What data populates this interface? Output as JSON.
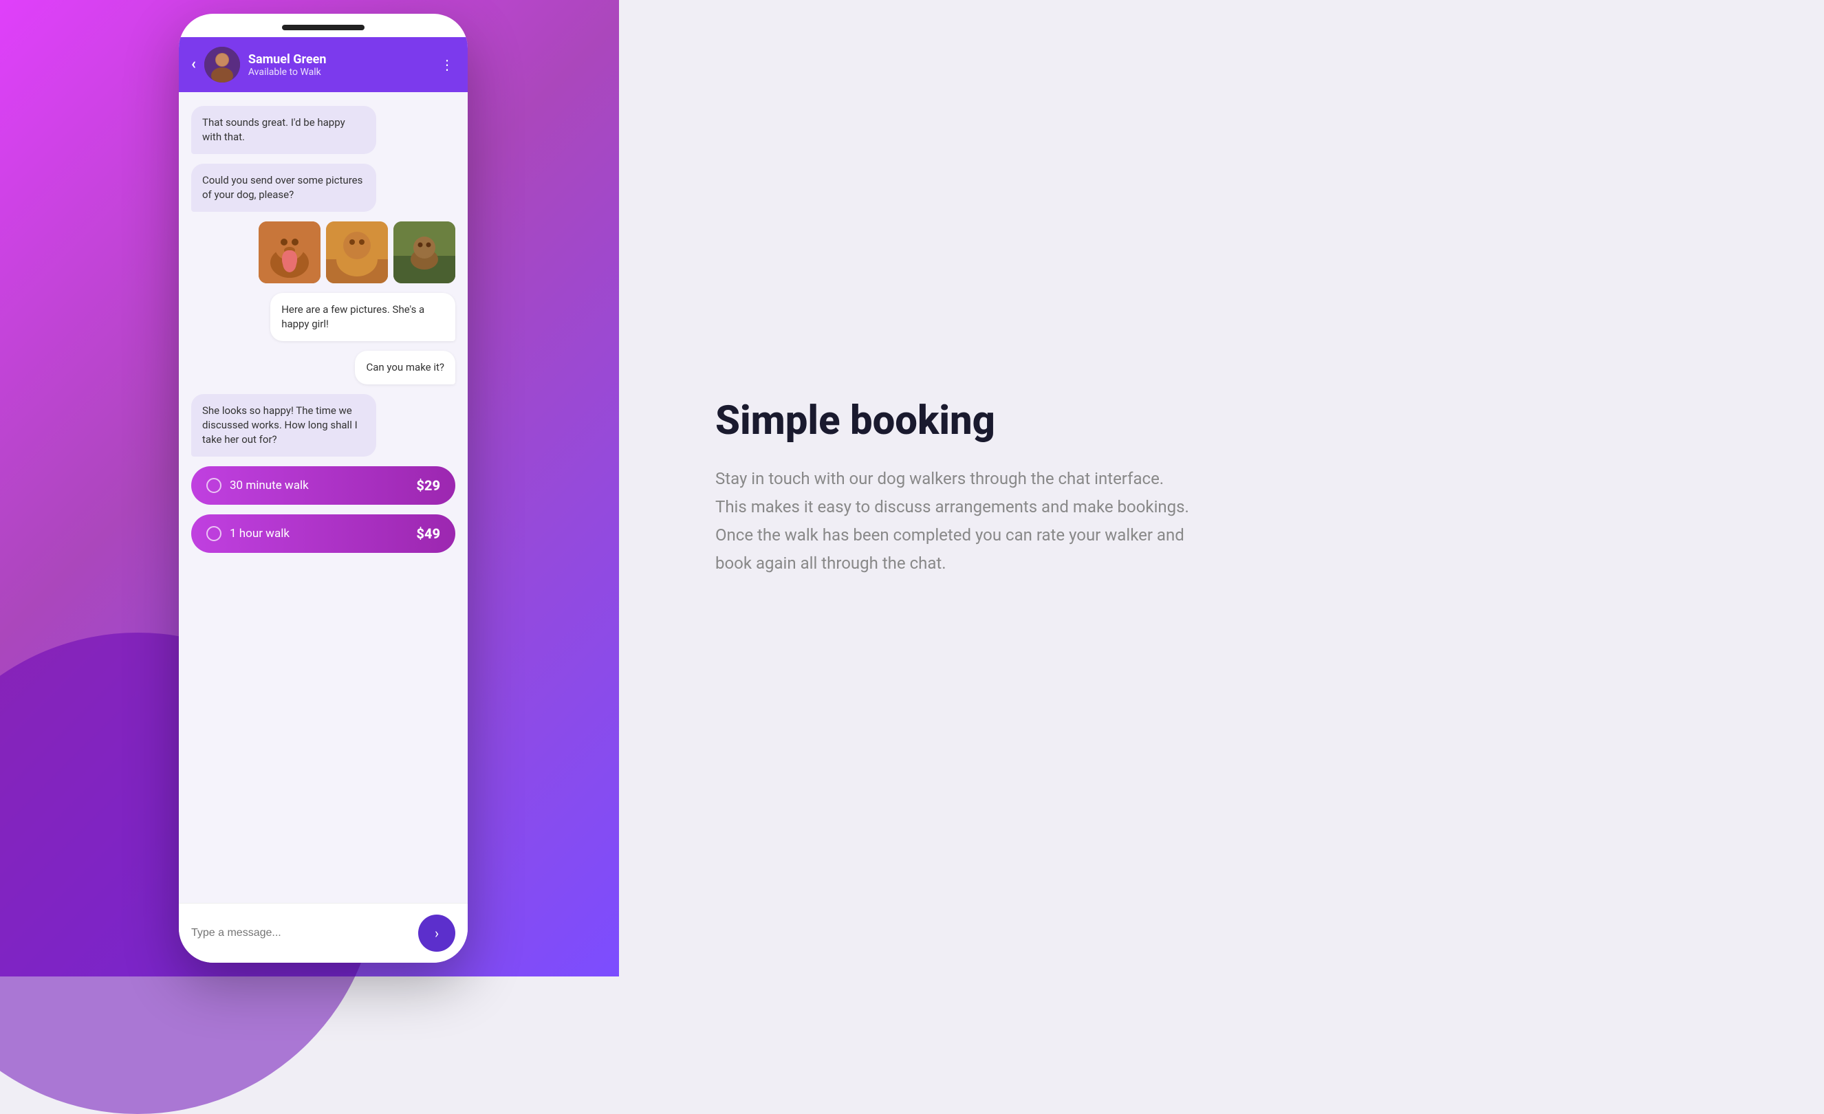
{
  "background": {
    "left_gradient_start": "#e040fb",
    "left_gradient_end": "#7c4dff"
  },
  "phone": {
    "notch": true
  },
  "header": {
    "back_label": "‹",
    "user_name": "Samuel Green",
    "user_status": "Available to Walk",
    "more_label": "⋮"
  },
  "messages": [
    {
      "id": 1,
      "type": "received",
      "text": "That sounds great. I'd be happy with that."
    },
    {
      "id": 2,
      "type": "received",
      "text": "Could you send over some pictures of your dog, please?"
    },
    {
      "id": 3,
      "type": "photos",
      "count": 3
    },
    {
      "id": 4,
      "type": "sent",
      "text": "Here are a few pictures. She's a happy girl!"
    },
    {
      "id": 5,
      "type": "sent",
      "text": "Can you make it?"
    },
    {
      "id": 6,
      "type": "received",
      "text": "She looks so happy! The time we discussed works. How long shall I take her out for?"
    }
  ],
  "walk_options": [
    {
      "id": 1,
      "label": "30 minute walk",
      "price": "$29"
    },
    {
      "id": 2,
      "label": "1 hour walk",
      "price": "$49"
    }
  ],
  "input": {
    "placeholder": "Type a message...",
    "send_arrow": "›"
  },
  "right_panel": {
    "title": "Simple booking",
    "description": "Stay in touch with our dog walkers through the chat interface. This makes it easy to discuss arrangements and make bookings. Once the walk has been completed you can rate your walker and book again all through the chat."
  }
}
